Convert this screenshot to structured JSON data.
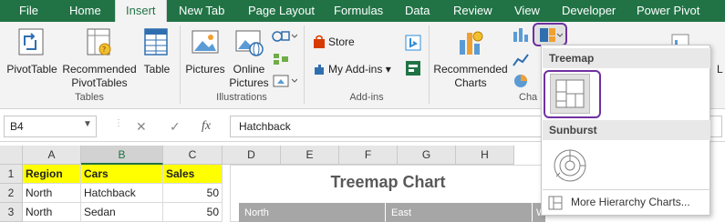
{
  "tabs": [
    "File",
    "Home",
    "Insert",
    "New Tab",
    "Page Layout",
    "Formulas",
    "Data",
    "Review",
    "View",
    "Developer",
    "Power Pivot"
  ],
  "active_tab": "Insert",
  "ribbon": {
    "tables": {
      "pivot": "PivotTable",
      "recommended_1": "Recommended",
      "recommended_2": "PivotTables",
      "table": "Table",
      "group": "Tables"
    },
    "illustrations": {
      "pictures": "Pictures",
      "online_1": "Online",
      "online_2": "Pictures",
      "group": "Illustrations"
    },
    "addins": {
      "store": "Store",
      "myaddins": "My Add-ins",
      "group": "Add-ins"
    },
    "charts": {
      "rec_1": "Recommended",
      "rec_2": "Charts",
      "group_partial": "Cha"
    },
    "partial_right": "L"
  },
  "formula_bar": {
    "namebox": "B4",
    "cancel": "✕",
    "enter": "✓",
    "fx": "fx",
    "value": "Hatchback"
  },
  "columns": [
    "A",
    "B",
    "C",
    "D",
    "E",
    "F",
    "G",
    "H"
  ],
  "rows": [
    {
      "num": "1",
      "a": "Region",
      "b": "Cars",
      "c": "Sales"
    },
    {
      "num": "2",
      "a": "North",
      "b": "Hatchback",
      "c": "50"
    },
    {
      "num": "3",
      "a": "North",
      "b": "Sedan",
      "c": "50"
    }
  ],
  "chart": {
    "title": "Treemap Chart",
    "labels": [
      "North",
      "East",
      "W"
    ]
  },
  "dropdown": {
    "treemap": "Treemap",
    "sunburst": "Sunburst",
    "more": "More Hierarchy Charts..."
  },
  "colors": {
    "excel_green": "#217346",
    "highlight": "#7030a0",
    "header_yellow": "#ffff00"
  }
}
